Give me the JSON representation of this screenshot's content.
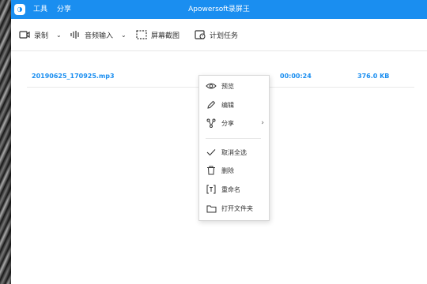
{
  "titlebar": {
    "logo": "◑",
    "menu": [
      "工具",
      "分享"
    ],
    "title": "Apowersoft录屏王"
  },
  "toolbar": {
    "record_label": "录制",
    "audio_label": "音频输入",
    "screenshot_label": "屏幕截图",
    "schedule_label": "计划任务"
  },
  "file": {
    "name": "20190625_170925.mp3",
    "duration": "00:00:24",
    "size": "376.0 KB"
  },
  "context_menu": {
    "preview": "预览",
    "edit": "编辑",
    "share": "分享",
    "deselect_all": "取消全选",
    "delete": "删除",
    "rename": "重命名",
    "open_folder": "打开文件夹"
  },
  "colors": {
    "accent": "#1a8ef0"
  }
}
